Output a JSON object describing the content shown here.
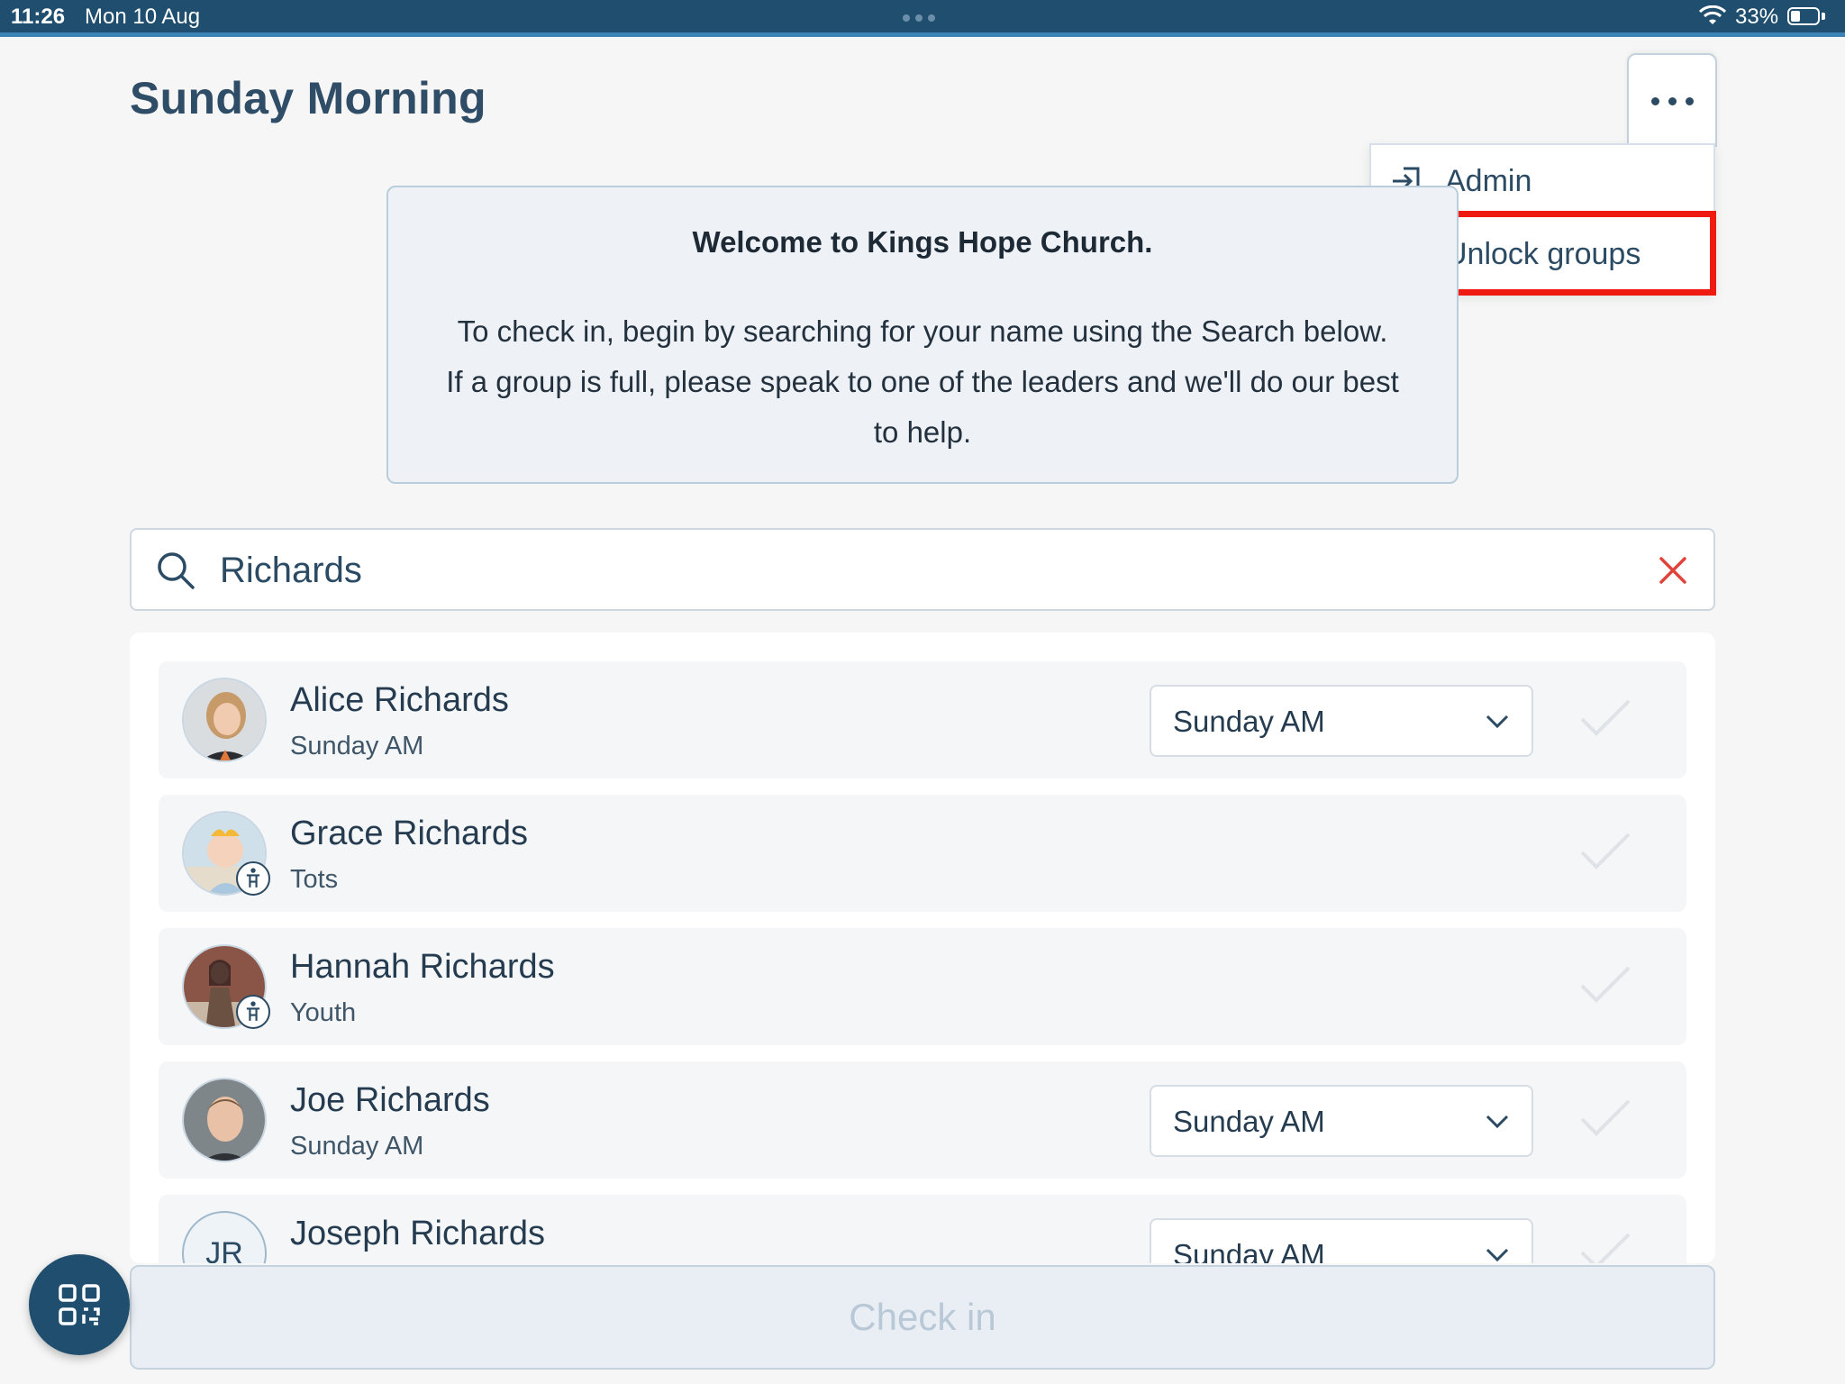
{
  "status_bar": {
    "time": "11:26",
    "date": "Mon 10 Aug",
    "battery": "33%",
    "battery_level": 0.33
  },
  "header": {
    "title": "Sunday Morning"
  },
  "menu": {
    "items": [
      {
        "label": "Admin",
        "icon": "sign-in-icon"
      },
      {
        "label": "Unlock groups",
        "icon": "people-group-icon"
      }
    ],
    "highlighted_item": "Unlock groups"
  },
  "welcome": {
    "title": "Welcome to Kings Hope Church.",
    "line1": "To check in, begin by searching for your name using the Search below.",
    "line2": "If a group is full, please speak to one of the leaders and we'll do our best",
    "line3": "to help."
  },
  "search": {
    "value": "Richards"
  },
  "people": [
    {
      "name": "Alice Richards",
      "group": "Sunday AM",
      "select": "Sunday AM",
      "child": false
    },
    {
      "name": "Grace Richards",
      "group": "Tots",
      "select": null,
      "child": true
    },
    {
      "name": "Hannah Richards",
      "group": "Youth",
      "select": null,
      "child": true
    },
    {
      "name": "Joe Richards",
      "group": "Sunday AM",
      "select": "Sunday AM",
      "child": false
    },
    {
      "name": "Joseph Richards",
      "group": "",
      "select": "Sunday AM",
      "initials": "JR",
      "child": false
    }
  ],
  "footer": {
    "checkin_label": "Check in"
  },
  "colors": {
    "primary": "#1f4e6e",
    "accent": "#3c83b5",
    "highlight": "#ef1b10",
    "clear": "#e0433c"
  }
}
